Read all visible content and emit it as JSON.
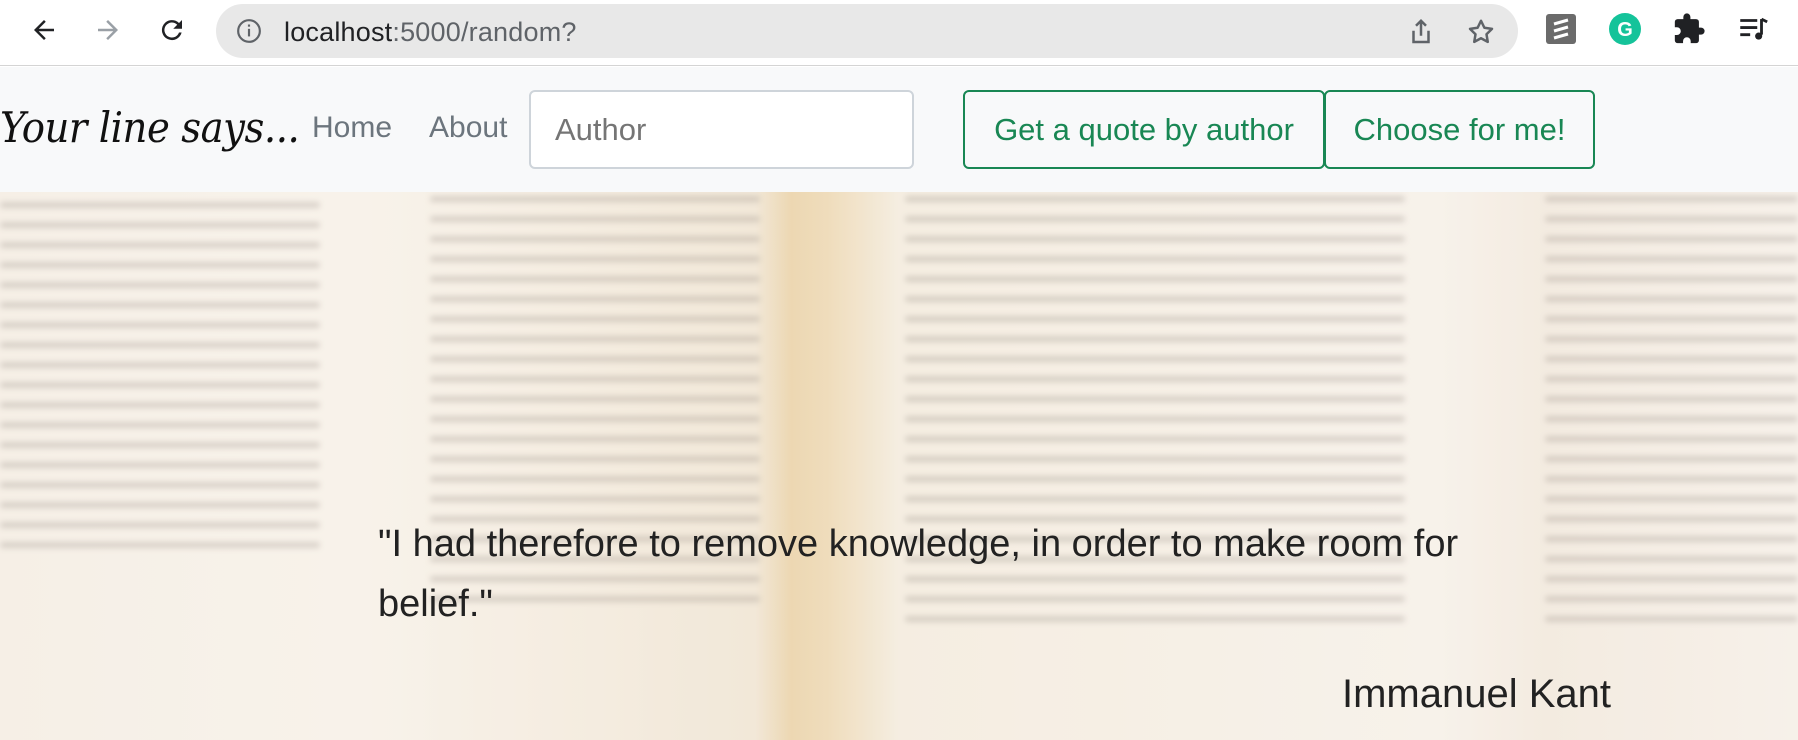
{
  "browser": {
    "url_host": "localhost",
    "url_rest": ":5000/random?",
    "icons": [
      "back-icon",
      "forward-icon",
      "reload-icon",
      "info-icon",
      "share-icon",
      "star-icon",
      "extension-stack-icon",
      "grammarly-icon",
      "puzzle-icon",
      "reading-list-icon"
    ]
  },
  "navbar": {
    "brand": "Your line says...",
    "links": [
      "Home",
      "About"
    ],
    "author_placeholder": "Author",
    "btn_by_author": "Get a quote by author",
    "btn_choose": "Choose for me!"
  },
  "quote": {
    "text": "\"I had therefore to remove knowledge, in order to make room for belief.\"",
    "author": "Immanuel Kant"
  },
  "colors": {
    "accent": "#198754",
    "navbar_bg": "#f8f9fa"
  }
}
